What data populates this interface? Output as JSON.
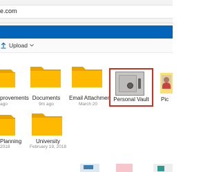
{
  "browser": {
    "address_text": "e.com"
  },
  "command_bar": {
    "upload_label": "Upload",
    "upload_icon": "upload-icon",
    "chevron_icon": "chevron-down-icon"
  },
  "colors": {
    "brand_blue": "#0364b8",
    "folder_yellow": "#ffb900",
    "vault_highlight": "#d52b1e"
  },
  "folders_row1": [
    {
      "name": "provements",
      "date": "ago"
    },
    {
      "name": "Documents",
      "date": "9m ago"
    },
    {
      "name": "Email Attachments",
      "date": "March 20"
    },
    {
      "name": "Personal Vault",
      "date": ""
    },
    {
      "name": "Pic",
      "date": ""
    }
  ],
  "folders_row2": [
    {
      "name": "Planning",
      "date": "2018"
    },
    {
      "name": "University",
      "date": "February 19, 2018"
    }
  ]
}
